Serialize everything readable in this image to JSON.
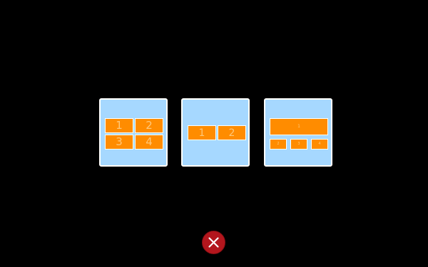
{
  "layouts": {
    "quad": {
      "panes": [
        "1",
        "2",
        "3",
        "4"
      ]
    },
    "split": {
      "panes": [
        "1",
        "2"
      ]
    },
    "pip": {
      "main": "1",
      "subs": [
        "2",
        "3",
        "4"
      ]
    }
  },
  "icons": {
    "close": "close-icon"
  },
  "colors": {
    "background": "#000000",
    "card_background": "#a6d8ff",
    "card_border": "#ffffff",
    "pane": "#ff8c00",
    "pane_text": "#ffc87a",
    "close_button": "#b3161d"
  }
}
